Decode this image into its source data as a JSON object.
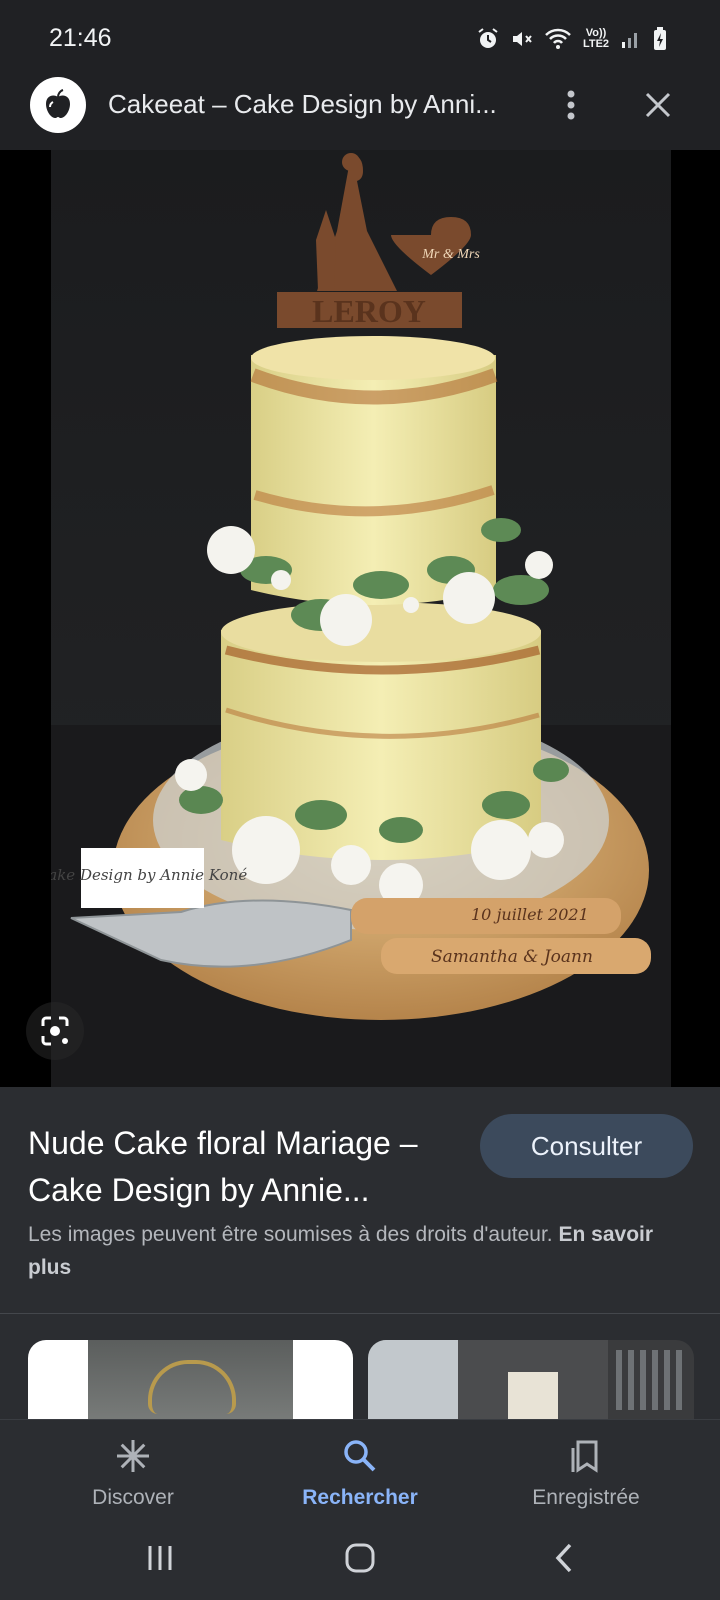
{
  "status_bar": {
    "time": "21:46",
    "network_label": "Vo)) LTE2",
    "icons": [
      "alarm-icon",
      "mute-icon",
      "wifi-icon",
      "signal-icon",
      "battery-charging-icon"
    ]
  },
  "header": {
    "site_title": "Cakeeat – Cake Design by Anni...",
    "logo_icon": "apple-logo-icon",
    "more_icon": "more-vert-icon",
    "close_icon": "close-icon"
  },
  "image": {
    "description_icon": "google-lens-icon",
    "watermark": "Cake Design by Annie Koné",
    "topper_text": "LEROY",
    "heart_text": "Mr & Mrs",
    "server_text_1": "10 juillet 2021",
    "server_text_2": "Samantha & Joann"
  },
  "result": {
    "title": "Nude Cake floral Mariage – Cake Design by Annie...",
    "consult_label": "Consulter",
    "copyright_text": "Les images peuvent être soumises à des droits d'auteur.",
    "learn_more": "En savoir plus"
  },
  "bottom_nav": {
    "items": [
      {
        "label": "Discover",
        "icon": "asterisk-icon",
        "active": false
      },
      {
        "label": "Rechercher",
        "icon": "search-icon",
        "active": true
      },
      {
        "label": "Enregistrée",
        "icon": "collections-icon",
        "active": false
      }
    ]
  },
  "colors": {
    "background": "#2b2d31",
    "header_bg": "#202124",
    "accent": "#8ab4f8",
    "button_bg": "#3c4a5c"
  }
}
